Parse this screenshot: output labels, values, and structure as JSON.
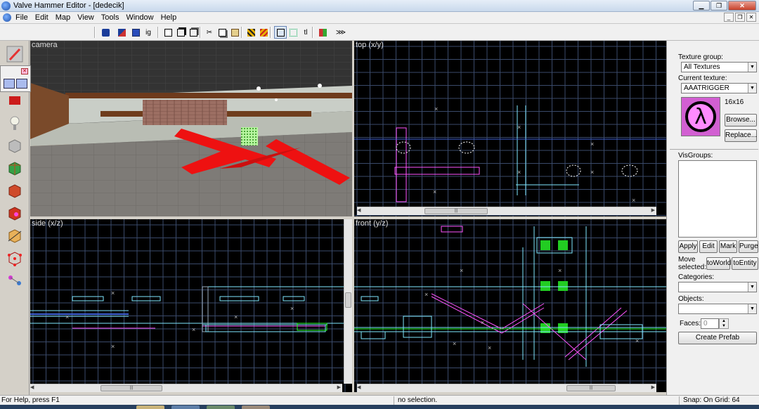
{
  "window": {
    "title": "Valve Hammer Editor - [dedecik]"
  },
  "menu": [
    "File",
    "Edit",
    "Map",
    "View",
    "Tools",
    "Window",
    "Help"
  ],
  "viewports": {
    "camera": "camera",
    "top": "top (x/y)",
    "side": "side (x/z)",
    "front": "front (y/z)"
  },
  "scroll_thumb_grip": "|||",
  "right_panel": {
    "texture_group_label": "Texture group:",
    "texture_group_value": "All Textures",
    "current_texture_label": "Current texture:",
    "current_texture_value": "AAATRIGGER",
    "texture_size": "16x16",
    "texture_glyph": "λ",
    "browse_button": "Browse...",
    "replace_button": "Replace...",
    "visgroups_label": "VisGroups:",
    "apply_button": "Apply",
    "edit_button": "Edit",
    "mark_button": "Mark",
    "purge_button": "Purge",
    "move_selected_label": "Move selected:",
    "to_world_button": "toWorld",
    "to_entity_button": "toEntity",
    "categories_label": "Categories:",
    "objects_label": "Objects:",
    "faces_label": "Faces:",
    "faces_value": "0",
    "create_prefab_button": "Create Prefab"
  },
  "status": {
    "help": "For Help, press F1",
    "selection": "no selection.",
    "snap": "Snap: On Grid: 64"
  },
  "colors": {
    "grid": "#3a4a6a",
    "grid_major": "#5d6f90",
    "brush_cyan": "#7fe8ff",
    "brush_magenta": "#ff55ff",
    "brush_green": "#22ff22",
    "trigger_red": "#ee1111"
  }
}
